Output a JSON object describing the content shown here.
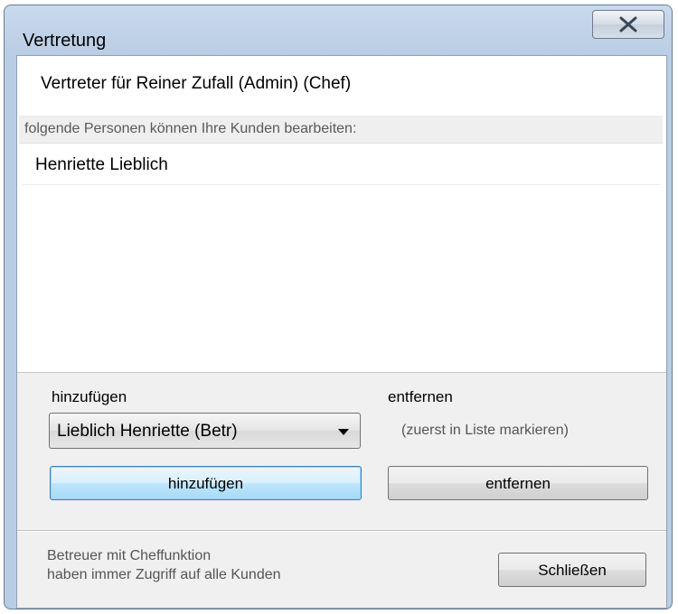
{
  "window": {
    "title": "Vertretung",
    "close_glyph": "X"
  },
  "header": {
    "text": "Vertreter für Reiner Zufall (Admin) (Chef)"
  },
  "list": {
    "caption": "folgende Personen können Ihre Kunden bearbeiten:",
    "items": [
      "Henriette Lieblich"
    ]
  },
  "add": {
    "label": "hinzufügen",
    "combo_value": "Lieblich Henriette (Betr)",
    "button_label": "hinzufügen"
  },
  "remove": {
    "label": "entfernen",
    "hint": "(zuerst in Liste markieren)",
    "button_label": "entfernen"
  },
  "footer": {
    "note_line1": "Betreuer mit Cheffunktion",
    "note_line2": "haben immer Zugriff auf alle Kunden",
    "close_button_label": "Schließen"
  },
  "icons": {
    "close": "close-icon",
    "dropdown": "chevron-down-icon"
  }
}
